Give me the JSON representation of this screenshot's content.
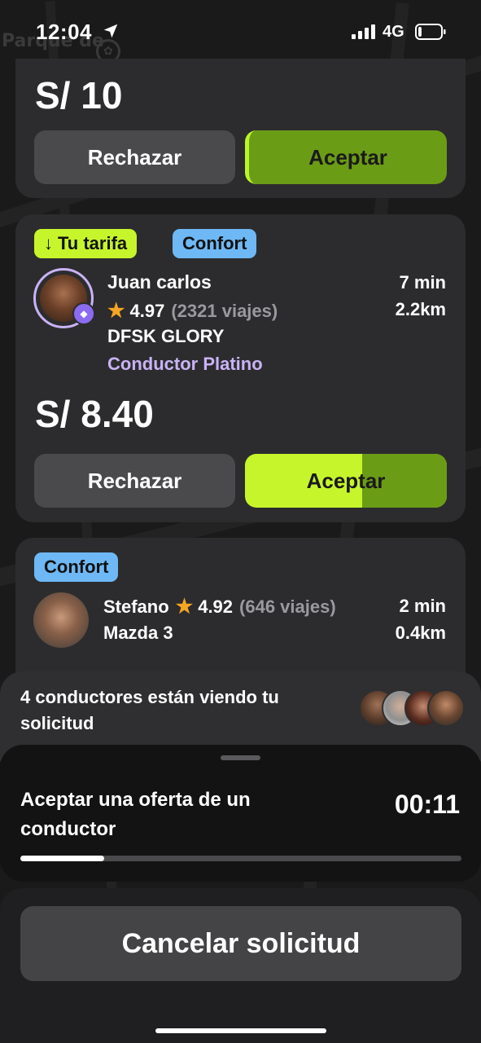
{
  "status_bar": {
    "time": "12:04",
    "network": "4G",
    "signal_bars": 4,
    "battery_level": 0.15
  },
  "map": {
    "park_label": "Parque de"
  },
  "offers": [
    {
      "price": "S/ 10",
      "reject_label": "Rechazar",
      "accept_label": "Aceptar"
    },
    {
      "fare_badge": "Tu tarifa",
      "fare_badge_icon": "down-arrow-icon",
      "category_badge": "Confort",
      "driver_name": "Juan carlos",
      "rating": "4.97",
      "trips": "(2321 viajes)",
      "car_model": "DFSK GLORY",
      "driver_tier": "Conductor Platino",
      "eta": "7 min",
      "distance": "2.2km",
      "price": "S/ 8.40",
      "reject_label": "Rechazar",
      "accept_label": "Aceptar",
      "accept_progress": 0.58
    },
    {
      "category_badge": "Confort",
      "driver_name": "Stefano",
      "rating": "4.92",
      "trips": "(646 viajes)",
      "car_model": "Mazda 3",
      "eta": "2 min",
      "distance": "0.4km"
    }
  ],
  "viewing": {
    "text": "4 conductores están viendo tu solicitud"
  },
  "countdown_sheet": {
    "text": "Aceptar una oferta de un conductor",
    "countdown": "00:11",
    "progress": 0.19
  },
  "cancel_button": "Cancelar solicitud",
  "colors": {
    "accent_green": "#c6f52c",
    "dark_green": "#6b9c16",
    "comfort_blue": "#6eb8f5",
    "platinum_purple": "#c9b3f5",
    "star_orange": "#f5a623"
  }
}
